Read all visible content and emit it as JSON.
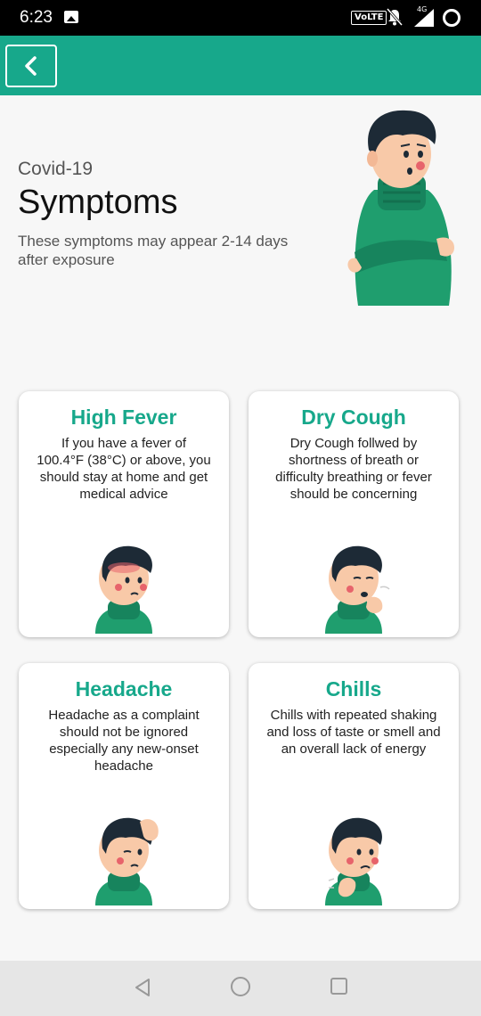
{
  "status_bar": {
    "time": "6:23",
    "volte": "VoLTE",
    "network": "4G",
    "icons": [
      "image-notification-icon",
      "bell-off-icon",
      "signal-icon",
      "battery-ring-icon"
    ]
  },
  "app_bar": {
    "color": "#17a88b",
    "back_icon": "chevron-left-icon"
  },
  "hero": {
    "eyebrow": "Covid-19",
    "title": "Symptoms",
    "description": "These symptoms may appear 2-14 days after exposure"
  },
  "symptoms": [
    {
      "title": "High Fever",
      "text": "If you have a fever of 100.4°F (38°C) or above, you should stay at home and get medical advice"
    },
    {
      "title": "Dry Cough",
      "text": "Dry Cough follwed by shortness of breath or difficulty breathing or fever should be concerning"
    },
    {
      "title": "Headache",
      "text": "Headache as a complaint should not be ignored especially any new-onset headache"
    },
    {
      "title": "Chills",
      "text": "Chills with repeated shaking and loss of taste or smell and an overall lack of energy"
    }
  ],
  "colors": {
    "accent": "#17a88b",
    "sweater": "#1f9e6e",
    "hair": "#1d2a36",
    "skin": "#f8c9a8"
  },
  "nav_bar": {
    "icons": [
      "nav-back-icon",
      "nav-home-icon",
      "nav-recents-icon"
    ]
  }
}
